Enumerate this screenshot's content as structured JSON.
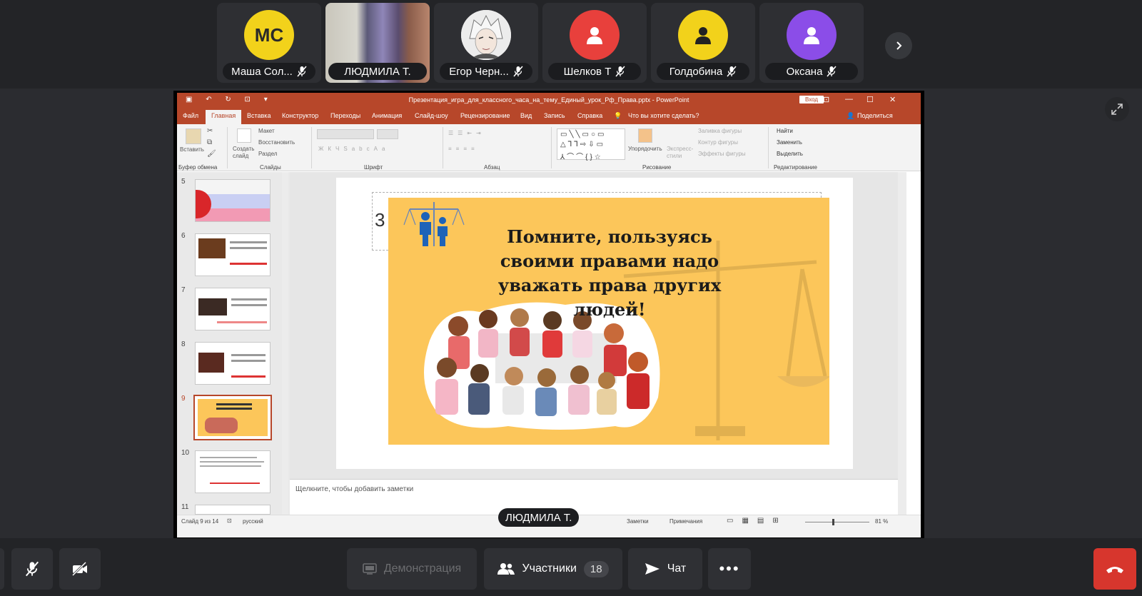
{
  "participants": [
    {
      "name": "Маша Сол...",
      "initials": "МС",
      "avatar_color": "#f2d21b",
      "muted": true
    },
    {
      "name": "ЛЮДМИЛА Т.",
      "video": true
    },
    {
      "name": "Егор Черн...",
      "muted": true
    },
    {
      "name": "Шелков Т",
      "avatar_color": "#e8403c",
      "muted": true
    },
    {
      "name": "Голдобина",
      "avatar_color": "#f2d21b",
      "muted": true
    },
    {
      "name": "Оксана",
      "avatar_color": "#8b4de8",
      "muted": true
    }
  ],
  "presenter_label": "ЛЮДМИЛА Т.",
  "ppt": {
    "window_title": "Презентация_игра_для_классного_часа_на_тему_Единый_урок_Рф_Права.pptx - PowerPoint",
    "login": "Вход",
    "tabs": [
      "Файл",
      "Главная",
      "Вставка",
      "Конструктор",
      "Переходы",
      "Анимация",
      "Слайд-шоу",
      "Рецензирование",
      "Вид",
      "Запись",
      "Справка",
      "Что вы хотите сделать?"
    ],
    "share_label": "Поделиться",
    "ribbon": {
      "paste": "Вставить",
      "clipboard": "Буфер обмена",
      "create_slide": "Создать слайд",
      "layout": "Макет",
      "reset": "Восстановить",
      "section": "Раздел",
      "slides_group": "Слайды",
      "font_group": "Шрифт",
      "paragraph_group": "Абзац",
      "arrange": "Упорядочить",
      "quick_styles": "Экспресс-стили",
      "shape_fill": "Заливка фигуры",
      "shape_outline": "Контур фигуры",
      "shape_effects": "Эффекты фигуры",
      "drawing_group": "Рисование",
      "find": "Найти",
      "replace": "Заменить",
      "select": "Выделить",
      "editing_group": "Редактирование"
    },
    "slide_numbers": [
      "5",
      "6",
      "7",
      "8",
      "9",
      "10",
      "11"
    ],
    "selected_slide": 9,
    "slide_placeholder_number": "3",
    "slide_text": "Помните, пользуясь своими правами надо уважать права других людей!",
    "notes_placeholder": "Щелкните, чтобы добавить заметки",
    "status": {
      "slide_counter": "Слайд 9 из 14",
      "language": "русский",
      "notes": "Заметки",
      "comments": "Примечания",
      "zoom": "81 %"
    }
  },
  "toolbar": {
    "screen_share": "Демонстрация",
    "participants": "Участники",
    "participants_count": "18",
    "chat": "Чат"
  }
}
